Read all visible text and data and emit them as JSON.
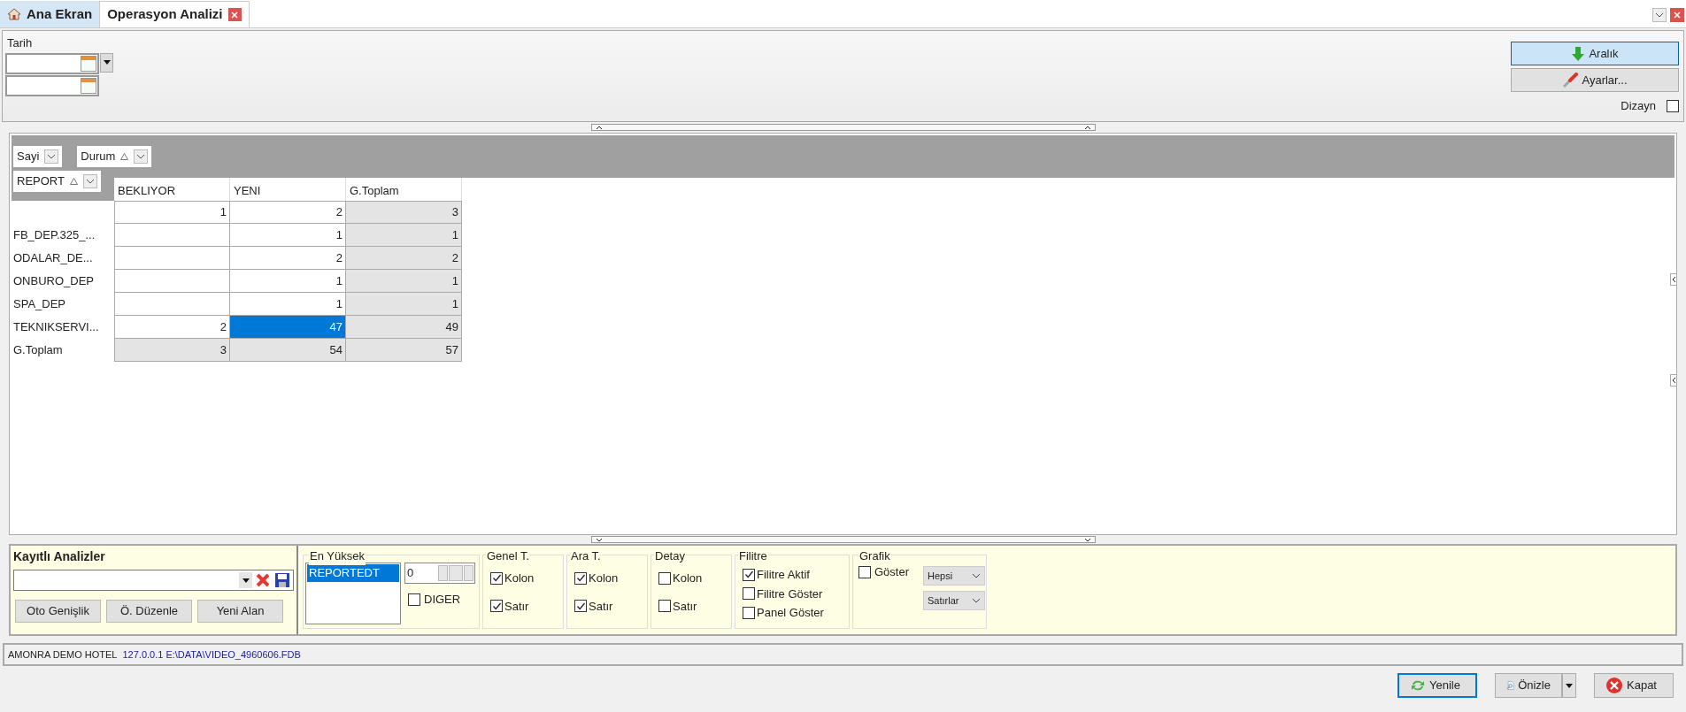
{
  "tabs": [
    {
      "label": "Ana Ekran",
      "kind": "home",
      "selected": false
    },
    {
      "label": "Operasyon Analizi",
      "kind": "closable",
      "selected": true
    }
  ],
  "filter": {
    "label": "Tarih"
  },
  "actions": [
    {
      "label": "Aralık",
      "kind": "down",
      "selected": true
    },
    {
      "label": "Ayarlar...",
      "kind": "settings",
      "selected": false
    }
  ],
  "design": {
    "label": "Dizayn",
    "checked": false
  },
  "pivot": {
    "data_fields": [
      {
        "label": "Sayi",
        "sorted": false
      }
    ],
    "column_fields": [
      {
        "label": "Durum",
        "sorted": true
      }
    ],
    "row_fields": [
      {
        "label": "REPORT",
        "sorted": true
      }
    ],
    "columns": [
      "BEKLIYOR",
      "YENI",
      "G.Toplam"
    ],
    "rows": [
      {
        "kind": "data",
        "cells": [
          {
            "text": "1",
            "selected": false
          },
          {
            "text": "2",
            "selected": false
          },
          {
            "text": "3",
            "selected": false
          }
        ]
      },
      {
        "label": "FB_DEP.325_...",
        "kind": "data",
        "cells": [
          {
            "selected": false
          },
          {
            "text": "1",
            "selected": false
          },
          {
            "text": "1",
            "selected": false
          }
        ]
      },
      {
        "label": "ODALAR_DE...",
        "kind": "data",
        "cells": [
          {
            "selected": false
          },
          {
            "text": "2",
            "selected": false
          },
          {
            "text": "2",
            "selected": false
          }
        ]
      },
      {
        "label": "ONBURO_DEP",
        "kind": "data",
        "cells": [
          {
            "selected": false
          },
          {
            "text": "1",
            "selected": false
          },
          {
            "text": "1",
            "selected": false
          }
        ]
      },
      {
        "label": "SPA_DEP",
        "kind": "data",
        "cells": [
          {
            "selected": false
          },
          {
            "text": "1",
            "selected": false
          },
          {
            "text": "1",
            "selected": false
          }
        ]
      },
      {
        "label": "TEKNIKSERVI...",
        "kind": "data",
        "cells": [
          {
            "text": "2",
            "selected": false
          },
          {
            "text": "47",
            "selected": true
          },
          {
            "text": "49",
            "selected": false
          }
        ]
      },
      {
        "label": "G.Toplam",
        "kind": "total",
        "cells": [
          {
            "text": "3",
            "selected": false
          },
          {
            "text": "54",
            "selected": false
          },
          {
            "text": "57",
            "selected": false
          }
        ]
      }
    ]
  },
  "saved": {
    "title": "Kayıtlı Analizler",
    "buttons": [
      "Oto Genişlik",
      "Ö. Düzenle",
      "Yeni Alan"
    ]
  },
  "top": {
    "title": "En Yüksek",
    "list": [
      {
        "label": "REPORTEDT",
        "selected": true
      }
    ],
    "spinner": "0",
    "other": {
      "label": "DIGER",
      "checked": false
    }
  },
  "groups": [
    {
      "title": "Genel T.",
      "options": [
        {
          "label": "Kolon",
          "checked": true
        },
        {
          "label": "Satır",
          "checked": true
        }
      ]
    },
    {
      "title": "Ara T.",
      "options": [
        {
          "label": "Kolon",
          "checked": true
        },
        {
          "label": "Satır",
          "checked": true
        }
      ]
    },
    {
      "title": "Detay",
      "options": [
        {
          "label": "Kolon",
          "checked": false
        },
        {
          "label": "Satır",
          "checked": false
        }
      ]
    },
    {
      "title": "Filitre",
      "options": [
        {
          "label": "Filitre Aktif",
          "checked": true
        },
        {
          "label": "Filitre Göster",
          "checked": false
        },
        {
          "label": "Panel Göster",
          "checked": false
        }
      ]
    }
  ],
  "grafik": {
    "title": "Grafik",
    "show": {
      "label": "Göster",
      "checked": false
    },
    "selects": [
      "Hepsi",
      "Satırlar"
    ]
  },
  "status": {
    "hotel": "AMONRA DEMO HOTEL",
    "connection": "127.0.0.1 E:\\DATA\\VIDEO_4960606.FDB"
  },
  "buttons": [
    {
      "label": "Yenile",
      "kind": "refresh",
      "selected": true
    },
    {
      "label": "Önizle",
      "kind": "preview",
      "selected": false
    },
    {
      "label": "Kapat",
      "kind": "close",
      "selected": false
    }
  ]
}
